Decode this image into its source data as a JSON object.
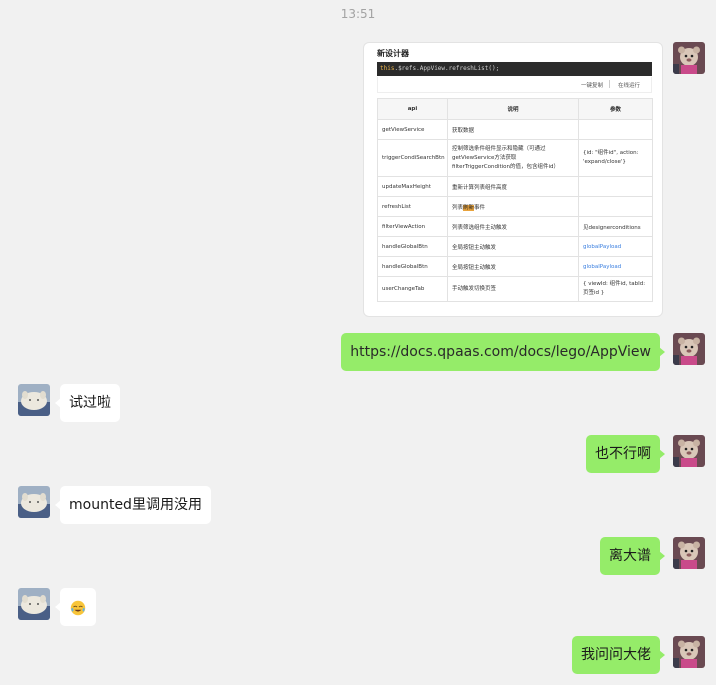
{
  "timestamp": "13:51",
  "image_message": {
    "title": "新设计器",
    "code_keyword": "this",
    "code_rest": ".$refs.AppView.refreshList();",
    "action_copy": "一键复制",
    "action_run": "在线运行",
    "table": {
      "headers": [
        "api",
        "说明",
        "参数"
      ],
      "rows": [
        {
          "api": "getViewService",
          "desc": "获取数据",
          "param": ""
        },
        {
          "api": "triggerCondiSearchBtn",
          "desc": "控制筛选条件组件显示和隐藏（可通过getViewService方法获取filterTriggerCondition的值，包含组件id）",
          "param": "{id: \"组件id\", action: 'expand/close'}"
        },
        {
          "api": "updateMaxHeight",
          "desc": "重新计算列表组件高度",
          "param": ""
        },
        {
          "api": "refreshList",
          "desc_pre": "列表",
          "desc_hl": "刷新",
          "desc_post": "事件",
          "param": ""
        },
        {
          "api": "filterViewAction",
          "desc": "列表筛选组件主动触发",
          "param": "见designerconditions"
        },
        {
          "api": "handleGlobalBtn",
          "desc": "全局按钮主动触发",
          "param": "globalPayload"
        },
        {
          "api": "handleGlobalBtn",
          "desc": "全局按钮主动触发",
          "param": "globalPayload"
        },
        {
          "api": "userChangeTab",
          "desc": "手动触发切换页签",
          "param": "{ viewId: 组件id, tabId: 页签id }"
        }
      ]
    }
  },
  "messages": [
    {
      "from": "me",
      "text": "https://docs.qpaas.com/docs/lego/AppView"
    },
    {
      "from": "other",
      "text": "试过啦"
    },
    {
      "from": "me",
      "text": "也不行啊"
    },
    {
      "from": "other",
      "text": "mounted里调用没用"
    },
    {
      "from": "me",
      "text": "离大谱"
    },
    {
      "from": "other",
      "emoji": "face-with-tears-emoji"
    },
    {
      "from": "me",
      "text": "我问问大佬"
    }
  ],
  "colors": {
    "background": "#f1f1f1",
    "my_bubble": "#95ec69",
    "their_bubble": "#ffffff",
    "link_blue": "#3a7fe0"
  }
}
